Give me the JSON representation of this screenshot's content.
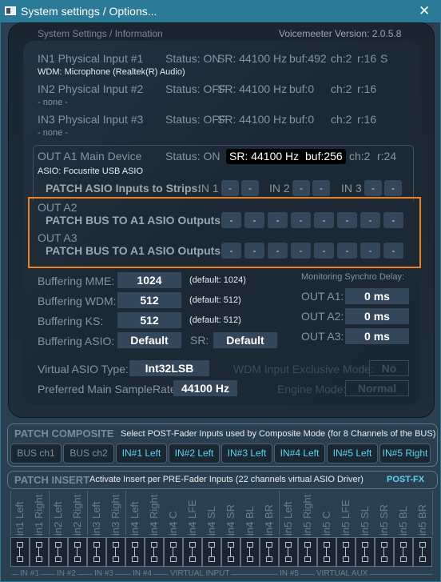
{
  "window": {
    "title": "System settings / Options...",
    "close": "✕"
  },
  "header": {
    "title": "System Settings / Information",
    "version": "Voicemeeter Version: 2.0.5.8"
  },
  "inputs": [
    {
      "name": "IN1 Physical Input #1",
      "status": "Status: ON",
      "sr": "SR: 44100 Hz",
      "buf": "buf:492",
      "ch": "ch:2",
      "r": "r:16",
      "extra": "S",
      "device": "WDM: Microphone (Realtek(R) Audio)"
    },
    {
      "name": "IN2 Physical Input #2",
      "status": "Status: OFF",
      "sr": "SR: 44100 Hz",
      "buf": "buf:0",
      "ch": "ch:2",
      "r": "r:16",
      "device": "- none -"
    },
    {
      "name": "IN3 Physical Input #3",
      "status": "Status: OFF",
      "sr": "SR: 44100 Hz",
      "buf": "buf:0",
      "ch": "ch:2",
      "r": "r:16",
      "device": "- none -"
    }
  ],
  "out_a1": {
    "name": "OUT A1 Main Device",
    "status": "Status: ON",
    "sr": "SR: 44100 Hz",
    "buf": "buf:256",
    "ch": "ch:2",
    "r": "r:24",
    "device": "ASIO: Focusrite USB ASIO",
    "patch_label": "PATCH ASIO Inputs to Strips:",
    "strips": [
      "IN 1",
      "IN 2",
      "IN 3"
    ],
    "btn": "-"
  },
  "out_a2": {
    "name": "OUT A2",
    "patch_label": "PATCH BUS TO A1 ASIO Outputs:"
  },
  "out_a3": {
    "name": "OUT A3",
    "patch_label": "PATCH BUS TO A1 ASIO Outputs:"
  },
  "highlight_color": "#f07f22",
  "buffering": [
    {
      "label": "Buffering MME:",
      "value": "1024",
      "default": "(default: 1024)"
    },
    {
      "label": "Buffering WDM:",
      "value": "512",
      "default": "(default: 512)"
    },
    {
      "label": "Buffering KS:",
      "value": "512",
      "default": "(default: 512)"
    },
    {
      "label": "Buffering ASIO:",
      "value": "Default",
      "sr_label": "SR:",
      "sr_value": "Default"
    }
  ],
  "sync": {
    "title": "Monitoring Synchro Delay:",
    "rows": [
      {
        "label": "OUT A1:",
        "value": "0 ms"
      },
      {
        "label": "OUT A2:",
        "value": "0 ms"
      },
      {
        "label": "OUT A3:",
        "value": "0 ms"
      }
    ]
  },
  "virtual_asio": {
    "label": "Virtual ASIO Type:",
    "value": "Int32LSB"
  },
  "samplerate": {
    "label": "Preferred Main SampleRate:",
    "value": "44100 Hz"
  },
  "wdm_excl": {
    "label": "WDM Input Exclusive Mode:",
    "value": "No"
  },
  "engine": {
    "label": "Engine Mode:",
    "value": "Normal"
  },
  "composite": {
    "title": "PATCH COMPOSITE",
    "desc": "Select POST-Fader Inputs used by Composite Mode (for 8 Channels of the BUS)",
    "buttons": [
      "BUS ch1",
      "BUS ch2",
      "IN#1 Left",
      "IN#2 Left",
      "IN#3 Left",
      "IN#4 Left",
      "IN#5 Left",
      "IN#5 Right"
    ]
  },
  "insert": {
    "title": "PATCH INSERT",
    "desc": "Activate Insert per PRE-Fader Inputs (22 channels virtual ASIO Driver)",
    "postfx": "POST-FX",
    "channels": [
      "in1 Left",
      "in1 Right",
      "in2 Left",
      "in2 Right",
      "in3 Left",
      "in3 Right",
      "in4 Left",
      "in4 Right",
      "in4 C",
      "in4 LFE",
      "in4 SL",
      "in4 SR",
      "in4 BL",
      "in4 BR",
      "in5 Left",
      "in5 Right",
      "in5 C",
      "in5 LFE",
      "in5 SL",
      "in5 SR",
      "in5 BL",
      "in5 BR"
    ],
    "groups": [
      "IN #1",
      "IN #2",
      "IN #3",
      "IN #4",
      "VIRTUAL INPUT",
      "IN #5",
      "VIRTUAL AUX"
    ]
  }
}
